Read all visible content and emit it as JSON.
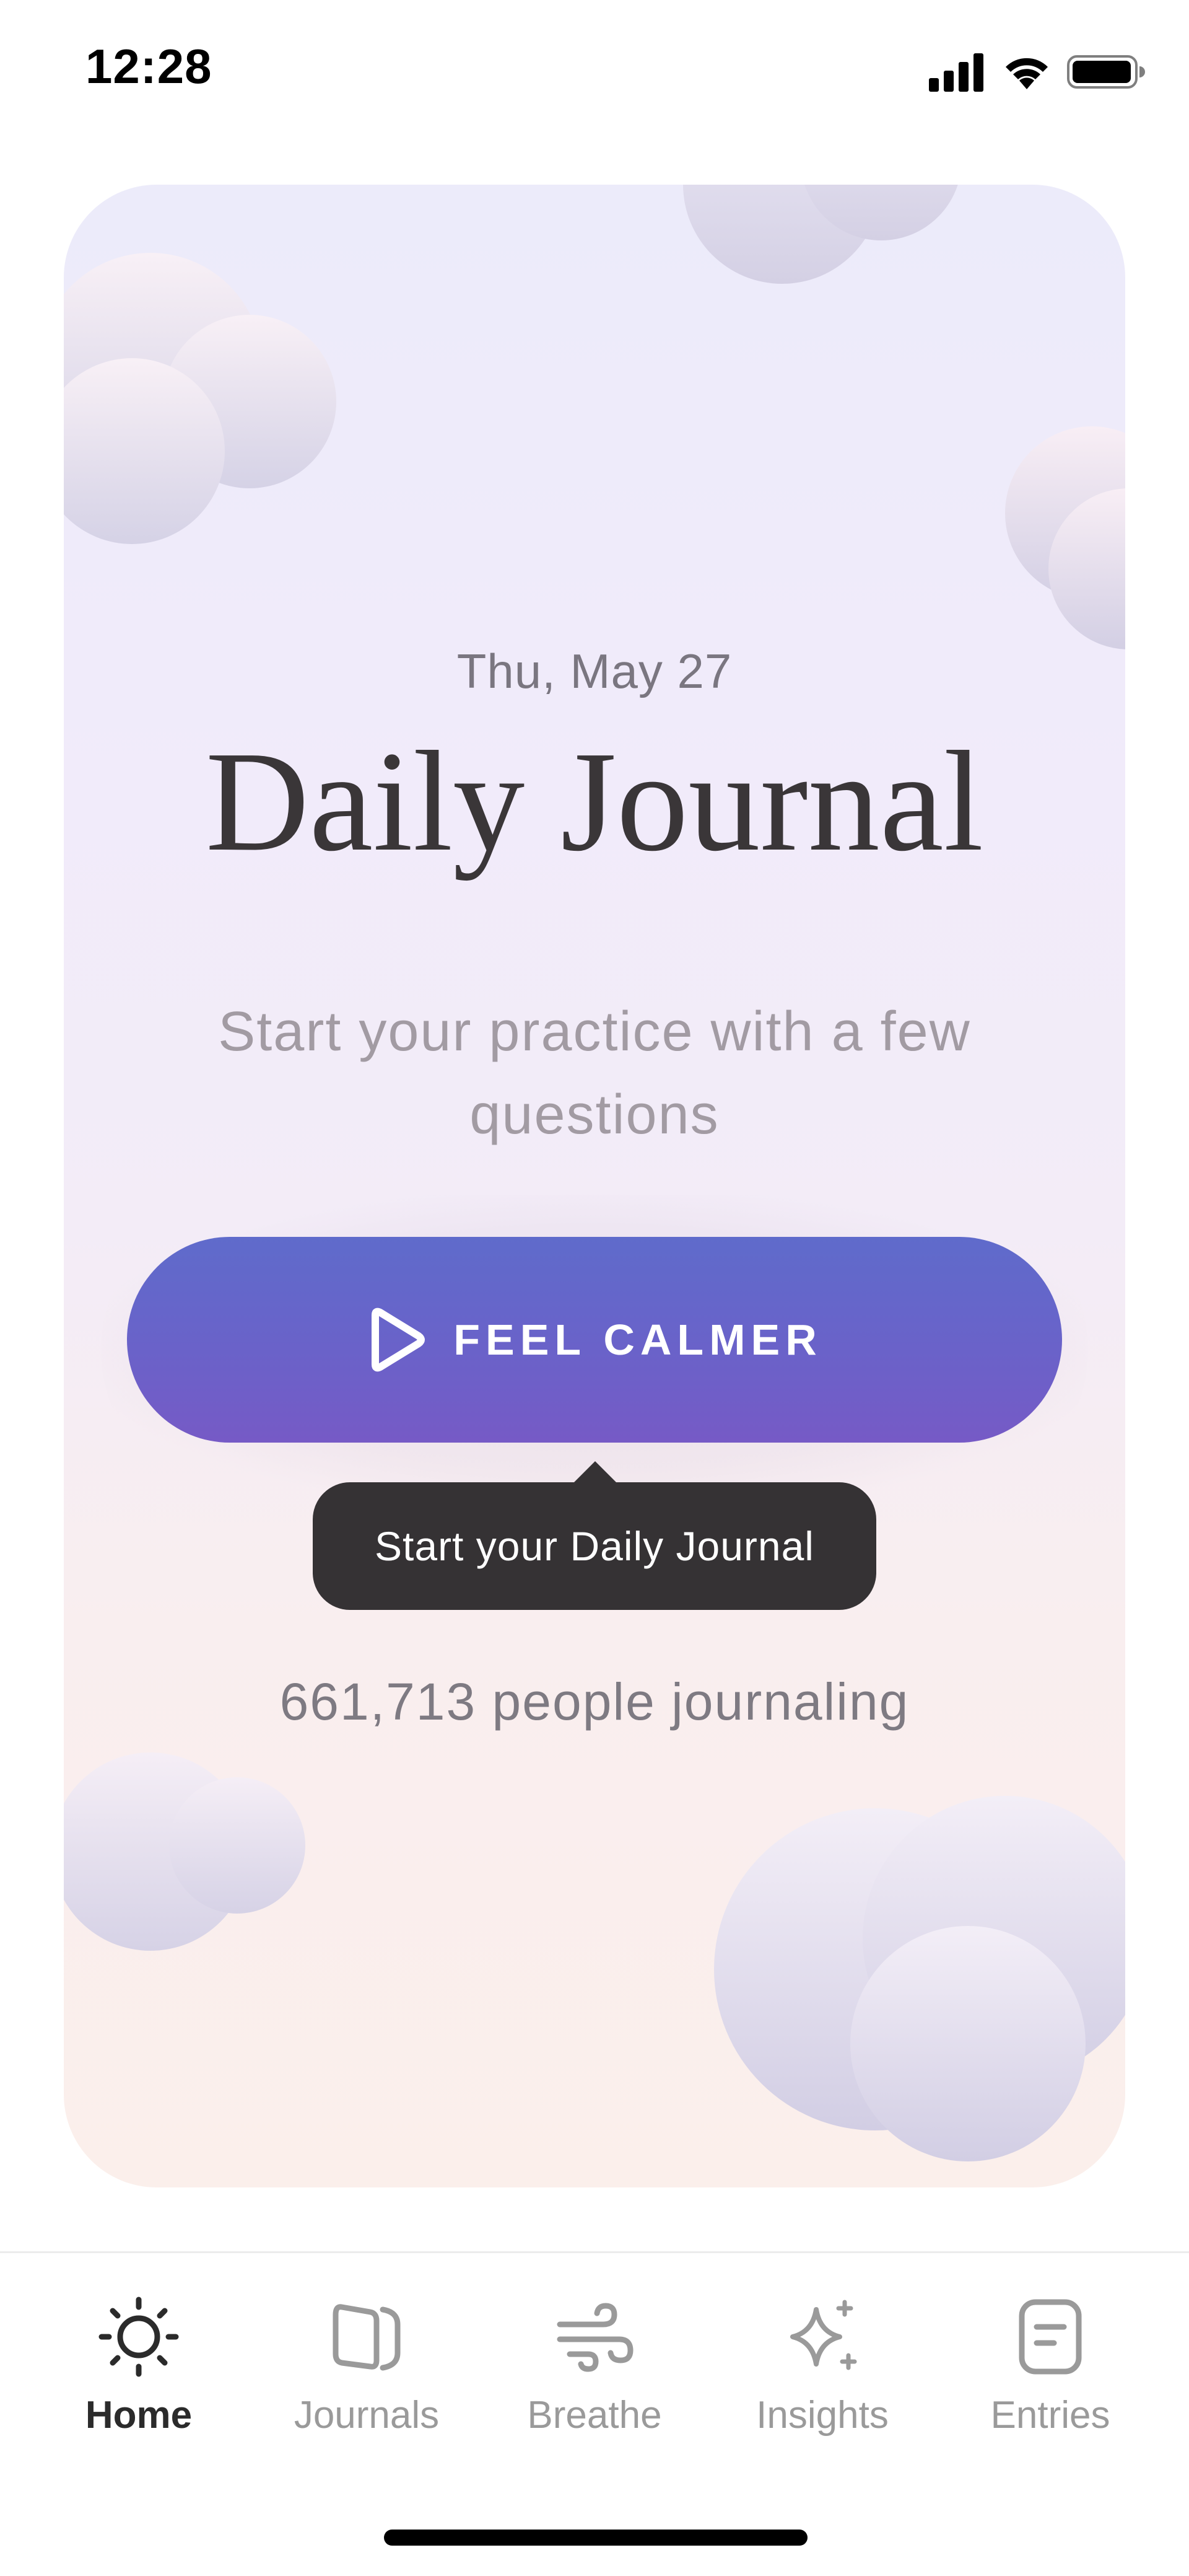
{
  "status_bar": {
    "time": "12:28",
    "icons": [
      "signal-icon",
      "wifi-icon",
      "battery-icon"
    ]
  },
  "card": {
    "date": "Thu, May 27",
    "title": "Daily Journal",
    "subtitle": "Start your practice with a few questions",
    "cta": {
      "label": "FEEL CALMER",
      "icon": "play-icon",
      "color_top": "#5f6bcb",
      "color_bottom": "#765ac6"
    },
    "tooltip": "Start your Daily Journal",
    "journaling_count": "661,713 people journaling"
  },
  "tab_bar": {
    "tabs": [
      {
        "label": "Home",
        "icon": "sun-icon",
        "active": true
      },
      {
        "label": "Journals",
        "icon": "journals-icon",
        "active": false
      },
      {
        "label": "Breathe",
        "icon": "wind-icon",
        "active": false
      },
      {
        "label": "Insights",
        "icon": "sparkle-icon",
        "active": false
      },
      {
        "label": "Entries",
        "icon": "entries-icon",
        "active": false
      }
    ]
  }
}
